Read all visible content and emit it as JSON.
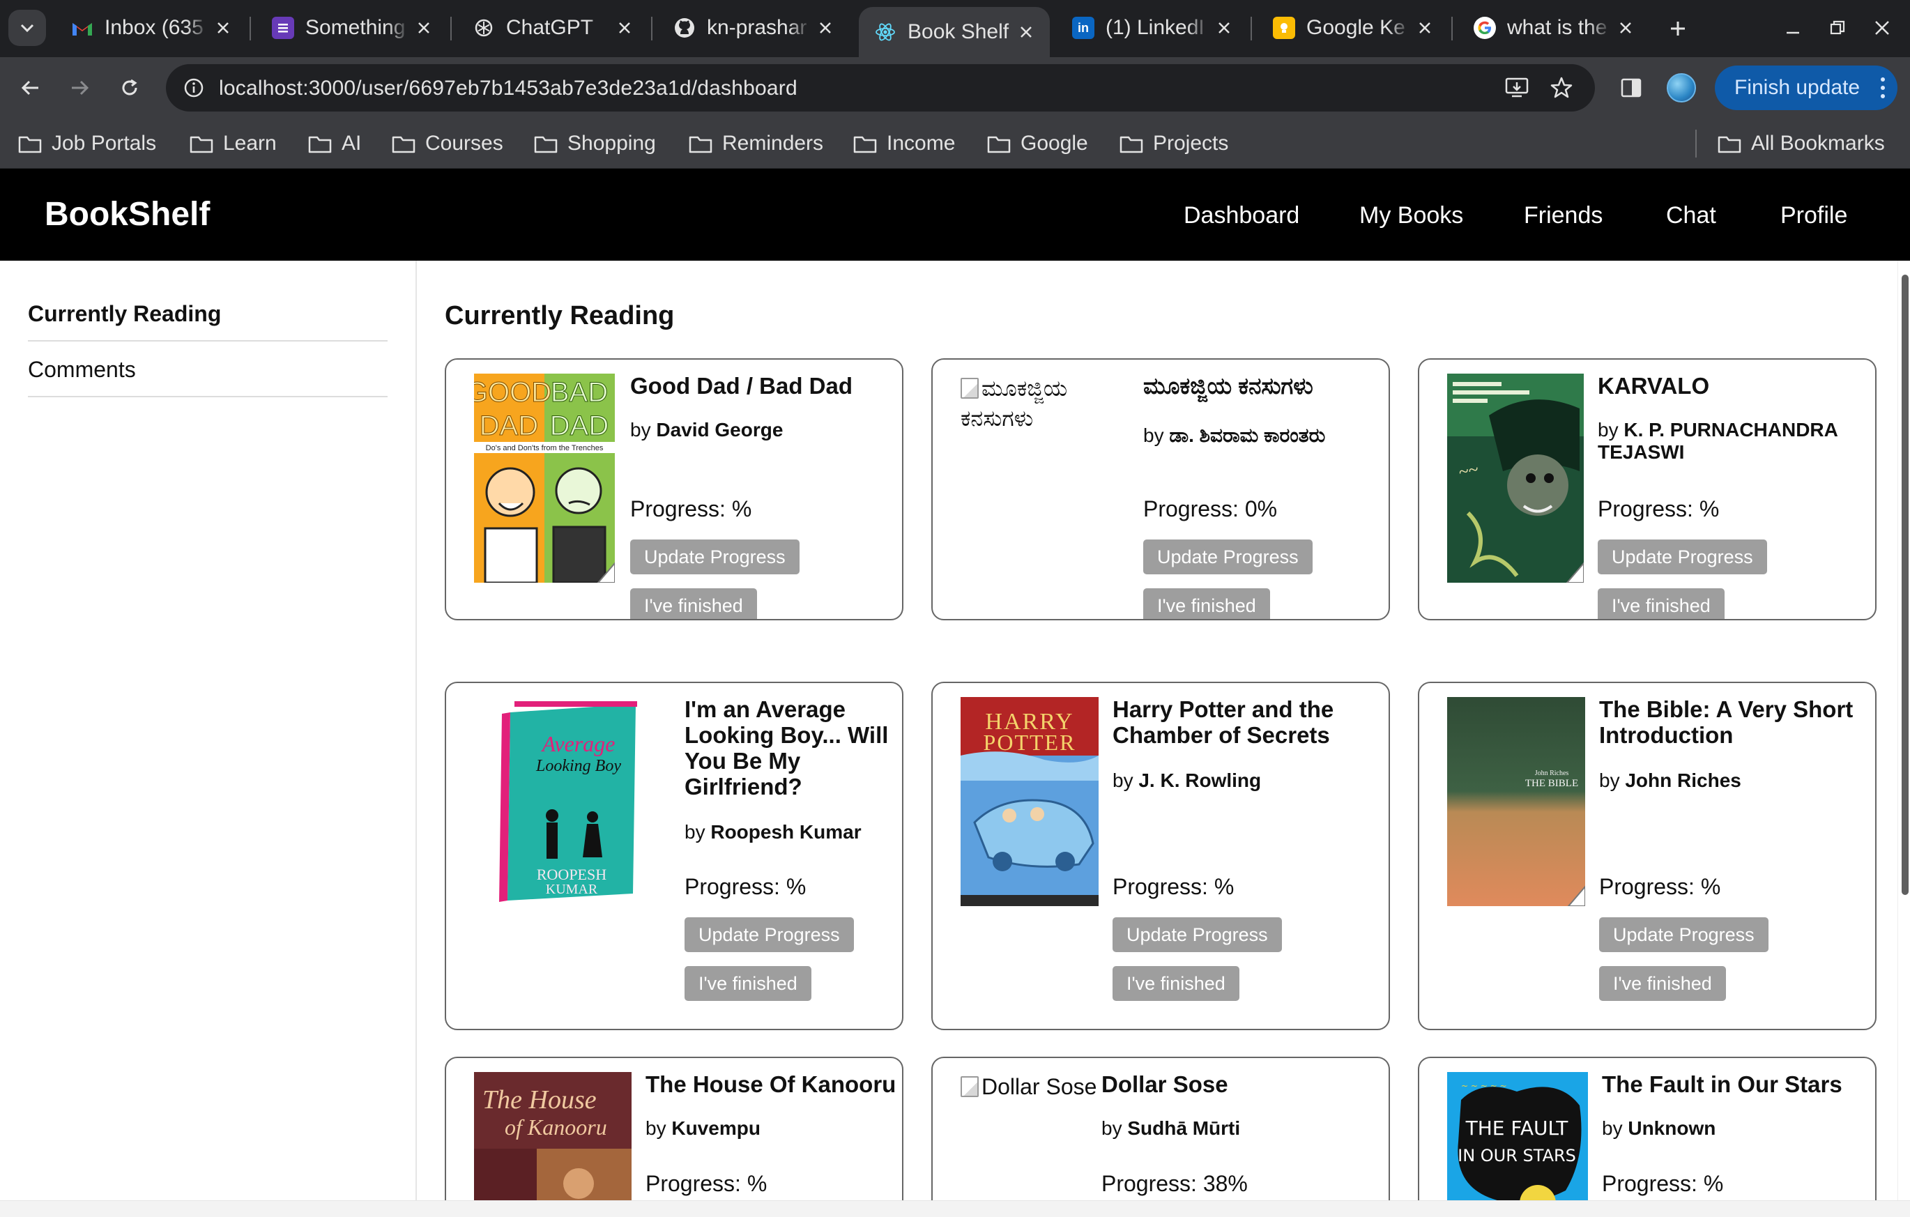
{
  "browser": {
    "tabs": [
      {
        "label": "Inbox (635",
        "icon": "gmail-icon",
        "active": false
      },
      {
        "label": "Something",
        "icon": "forms-icon",
        "active": false
      },
      {
        "label": "ChatGPT",
        "icon": "chatgpt-icon",
        "active": false
      },
      {
        "label": "kn-prashar",
        "icon": "github-icon",
        "active": false
      },
      {
        "label": "Book Shelf",
        "icon": "react-icon",
        "active": true
      },
      {
        "label": "(1) LinkedI",
        "icon": "linkedin-icon",
        "active": false
      },
      {
        "label": "Google Ke",
        "icon": "keep-icon",
        "active": false
      },
      {
        "label": "what is the",
        "icon": "google-icon",
        "active": false
      }
    ],
    "url": "localhost:3000/user/6697eb7b1453ab7e3de23a1d/dashboard",
    "update_button": "Finish update",
    "bookmarks": [
      "Job Portals",
      "Learn",
      "AI",
      "Courses",
      "Shopping",
      "Reminders",
      "Income",
      "Google",
      "Projects"
    ],
    "all_bookmarks": "All Bookmarks"
  },
  "app": {
    "brand": "BookShelf",
    "nav": [
      "Dashboard",
      "My Books",
      "Friends",
      "Chat",
      "Profile"
    ]
  },
  "sidebar": {
    "items": [
      "Currently Reading",
      "Comments"
    ],
    "active": "Currently Reading"
  },
  "main": {
    "title": "Currently Reading",
    "update_label": "Update Progress",
    "finished_label": "I've finished",
    "books": [
      {
        "title": "Good Dad / Bad Dad",
        "by": "by",
        "author": "David George",
        "progress": "Progress: %",
        "cover_alt": "",
        "cover": {
          "type": "good-dad",
          "text_a": "GOOD",
          "text_b": "BAD",
          "text_c": "DAD",
          "text_d": "DAD",
          "subtitle": "Do's and Don'ts from the Trenches"
        }
      },
      {
        "title": "ಮೂಕಜ್ಜಿಯ ಕನಸುಗಳು",
        "by": "by",
        "author": "ಡಾ. ಶಿವರಾಮ ಕಾರಂತರು",
        "progress": "Progress: 0%",
        "cover_alt": "ಮೂಕಜ್ಜಿಯ ಕನಸುಗಳು",
        "cover": null
      },
      {
        "title": "KARVALO",
        "by": "by",
        "author": "K. P. PURNACHANDRA TEJASWI",
        "progress": "Progress: %",
        "cover_alt": "",
        "cover": {
          "type": "karvalo"
        }
      },
      {
        "title": "I'm an Average Looking Boy... Will You Be My Girlfriend?",
        "by": "by",
        "author": "Roopesh Kumar",
        "progress": "Progress: %",
        "cover_alt": "",
        "cover": {
          "type": "average-boy"
        }
      },
      {
        "title": "Harry Potter and the Chamber of Secrets",
        "by": "by",
        "author": "J. K. Rowling",
        "progress": "Progress: %",
        "cover_alt": "",
        "cover": {
          "type": "harry-potter",
          "text_a": "HARRY",
          "text_b": "POTTER"
        }
      },
      {
        "title": "The Bible: A Very Short Introduction",
        "by": "by",
        "author": "John Riches",
        "progress": "Progress: %",
        "cover_alt": "",
        "cover": {
          "type": "bible",
          "text_a": "THE BIBLE"
        }
      },
      {
        "title": "The House Of Kanooru",
        "by": "by",
        "author": "Kuvempu",
        "progress": "Progress: %",
        "cover_alt": "",
        "cover": {
          "type": "kanooru",
          "text_a": "The House",
          "text_b": "of Kanooru"
        }
      },
      {
        "title": "Dollar Sose",
        "by": "by",
        "author": "Sudhā Mūrti",
        "progress": "Progress: 38%",
        "cover_alt": "Dollar Sose",
        "cover": null
      },
      {
        "title": "The Fault in Our Stars",
        "by": "by",
        "author": "Unknown",
        "progress": "Progress: %",
        "cover_alt": "",
        "cover": {
          "type": "fault-stars",
          "text_a": "THE FAULT",
          "text_b": "IN OUR STARS"
        }
      }
    ]
  }
}
